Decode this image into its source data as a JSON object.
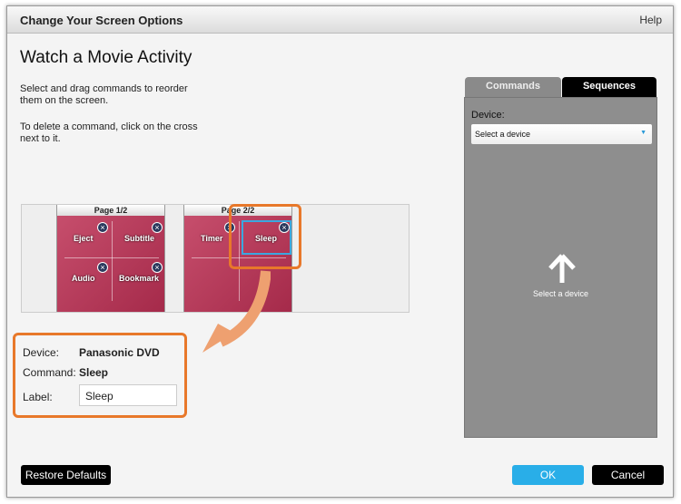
{
  "window": {
    "title": "Change Your Screen Options",
    "help": "Help"
  },
  "heading": "Watch a Movie Activity",
  "instructions": [
    "Select and drag commands to reorder them on the screen.",
    "To delete a command, click on the cross next to it."
  ],
  "pages": [
    {
      "title": "Page 1/2",
      "commands": [
        "Eject",
        "Subtitle",
        "Audio",
        "Bookmark"
      ]
    },
    {
      "title": "Page 2/2",
      "commands": [
        "Timer",
        "Sleep"
      ]
    }
  ],
  "details": {
    "device_label": "Device:",
    "device_value": "Panasonic DVD",
    "command_label": "Command:",
    "command_value": "Sleep",
    "label_label": "Label:",
    "label_value": "Sleep"
  },
  "panel": {
    "tabs": [
      "Commands",
      "Sequences"
    ],
    "device_label": "Device:",
    "device_select": "Select a device",
    "hint": "Select a device"
  },
  "buttons": {
    "restore": "Restore Defaults",
    "ok": "OK",
    "cancel": "Cancel"
  },
  "colors": {
    "highlight": "#e8782a",
    "selected": "#3aa8e0",
    "ok": "#29aee8"
  }
}
